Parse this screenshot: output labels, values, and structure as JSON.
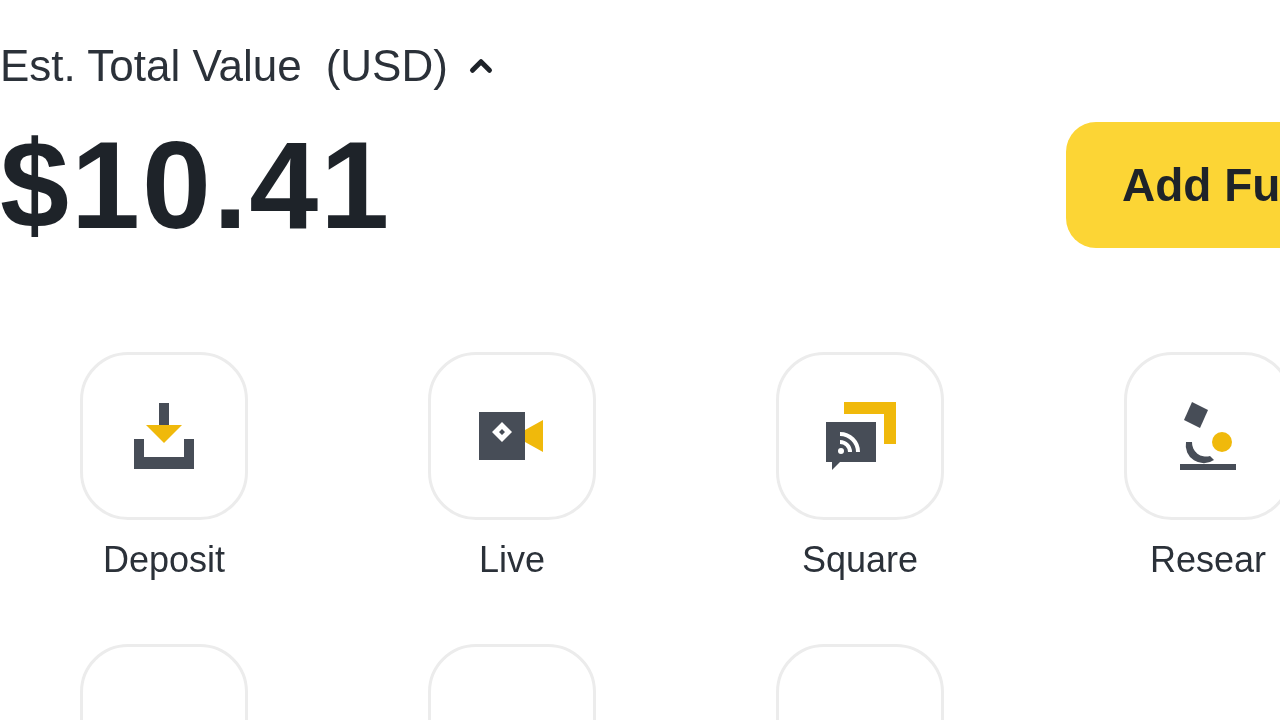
{
  "total_value": {
    "label": "Est. Total Value",
    "currency": "(USD)",
    "expanded": true
  },
  "balance": "$10.41",
  "add_funds_button": "Add Fu",
  "shortcuts": [
    {
      "kind": "deposit",
      "label": "Deposit"
    },
    {
      "kind": "live",
      "label": "Live"
    },
    {
      "kind": "square",
      "label": "Square"
    },
    {
      "kind": "research",
      "label": "Resear"
    }
  ]
}
